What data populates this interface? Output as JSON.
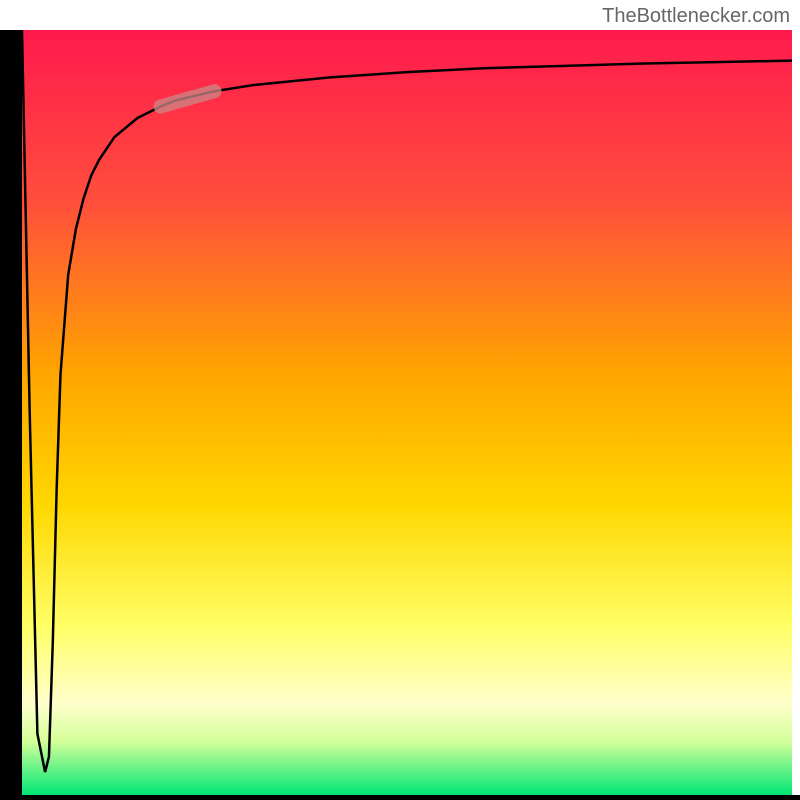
{
  "attribution": "TheBottlenecker.com",
  "chart_data": {
    "type": "line",
    "title": "",
    "xlabel": "",
    "ylabel": "",
    "xlim": [
      0,
      100
    ],
    "ylim": [
      0,
      100
    ],
    "x": [
      0,
      1,
      2,
      3,
      3.5,
      4,
      4.5,
      5,
      6,
      7,
      8,
      9,
      10,
      12,
      15,
      18,
      20,
      25,
      30,
      35,
      40,
      50,
      60,
      70,
      80,
      90,
      100
    ],
    "values": [
      100,
      50,
      8,
      3,
      5,
      20,
      40,
      55,
      68,
      74,
      78,
      81,
      83,
      86,
      88.5,
      90,
      90.8,
      92,
      92.8,
      93.3,
      93.8,
      94.5,
      95,
      95.3,
      95.6,
      95.8,
      96
    ],
    "highlight_segment": {
      "x_start": 18,
      "x_end": 25,
      "y_start": 90,
      "y_end": 92
    },
    "gradient_colors": {
      "top": "#FF1A4D",
      "mid1": "#FF7A00",
      "mid2": "#FFD700",
      "mid3": "#FFFF66",
      "mid4": "#D4FF66",
      "bottom": "#00E676"
    }
  }
}
